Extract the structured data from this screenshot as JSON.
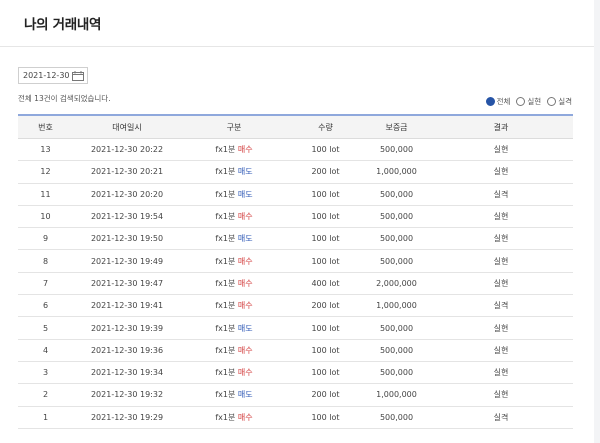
{
  "header": {
    "title": "나의 거래내역"
  },
  "filter": {
    "date": "2021-12-30",
    "result_count": "전체 13건이 검색되었습니다.",
    "radios": [
      {
        "label": "전체",
        "checked": true
      },
      {
        "label": "실현",
        "checked": false
      },
      {
        "label": "실격",
        "checked": false
      }
    ]
  },
  "table": {
    "headers": [
      "번호",
      "대여일시",
      "구분",
      "수량",
      "보증금",
      "결과"
    ],
    "rows": [
      {
        "no": "13",
        "datetime": "2021-12-30 20:22",
        "product": "fx1분",
        "side": "매수",
        "qty": "100 lot",
        "margin": "500,000",
        "result": "실현"
      },
      {
        "no": "12",
        "datetime": "2021-12-30 20:21",
        "product": "fx1분",
        "side": "매도",
        "qty": "200 lot",
        "margin": "1,000,000",
        "result": "실현"
      },
      {
        "no": "11",
        "datetime": "2021-12-30 20:20",
        "product": "fx1분",
        "side": "매도",
        "qty": "100 lot",
        "margin": "500,000",
        "result": "실격"
      },
      {
        "no": "10",
        "datetime": "2021-12-30 19:54",
        "product": "fx1분",
        "side": "매수",
        "qty": "100 lot",
        "margin": "500,000",
        "result": "실현"
      },
      {
        "no": "9",
        "datetime": "2021-12-30 19:50",
        "product": "fx1분",
        "side": "매도",
        "qty": "100 lot",
        "margin": "500,000",
        "result": "실현"
      },
      {
        "no": "8",
        "datetime": "2021-12-30 19:49",
        "product": "fx1분",
        "side": "매수",
        "qty": "100 lot",
        "margin": "500,000",
        "result": "실현"
      },
      {
        "no": "7",
        "datetime": "2021-12-30 19:47",
        "product": "fx1분",
        "side": "매수",
        "qty": "400 lot",
        "margin": "2,000,000",
        "result": "실현"
      },
      {
        "no": "6",
        "datetime": "2021-12-30 19:41",
        "product": "fx1분",
        "side": "매수",
        "qty": "200 lot",
        "margin": "1,000,000",
        "result": "실격"
      },
      {
        "no": "5",
        "datetime": "2021-12-30 19:39",
        "product": "fx1분",
        "side": "매도",
        "qty": "100 lot",
        "margin": "500,000",
        "result": "실현"
      },
      {
        "no": "4",
        "datetime": "2021-12-30 19:36",
        "product": "fx1분",
        "side": "매수",
        "qty": "100 lot",
        "margin": "500,000",
        "result": "실현"
      },
      {
        "no": "3",
        "datetime": "2021-12-30 19:34",
        "product": "fx1분",
        "side": "매수",
        "qty": "100 lot",
        "margin": "500,000",
        "result": "실현"
      },
      {
        "no": "2",
        "datetime": "2021-12-30 19:32",
        "product": "fx1분",
        "side": "매도",
        "qty": "200 lot",
        "margin": "1,000,000",
        "result": "실현"
      },
      {
        "no": "1",
        "datetime": "2021-12-30 19:29",
        "product": "fx1분",
        "side": "매수",
        "qty": "100 lot",
        "margin": "500,000",
        "result": "실격"
      }
    ]
  },
  "colors": {
    "buy": "#d23b3b",
    "sell": "#2f59b6",
    "realized": "#3a64c2",
    "failed": "#d23b3b",
    "table_top_border": "#8fa8dc",
    "radio_selected": "#2654a6"
  },
  "icons": {
    "date_picker": "calendar-icon"
  }
}
